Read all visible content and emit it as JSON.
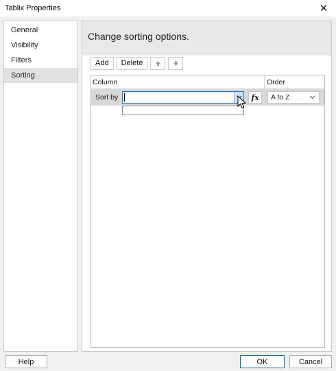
{
  "window": {
    "title": "Tablix Properties",
    "close_glyph": "✕"
  },
  "nav": {
    "items": [
      {
        "label": "General",
        "selected": false
      },
      {
        "label": "Visibility",
        "selected": false
      },
      {
        "label": "Filters",
        "selected": false
      },
      {
        "label": "Sorting",
        "selected": true
      }
    ]
  },
  "main": {
    "heading": "Change sorting options.",
    "toolbar": {
      "add_label": "Add",
      "delete_label": "Delete",
      "move_up_icon": "arrow-up-icon",
      "move_down_icon": "arrow-down-icon"
    },
    "grid": {
      "column_header": "Column",
      "order_header": "Order",
      "rows": [
        {
          "label": "Sort by",
          "column_value": "",
          "order_value": "A to Z"
        }
      ]
    }
  },
  "footer": {
    "help_label": "Help",
    "ok_label": "OK",
    "cancel_label": "Cancel"
  },
  "colors": {
    "accent": "#0067c0",
    "selected_nav": "#e1e1e1",
    "header_band": "#e8e8e8",
    "sort_row": "#d8d8d8"
  }
}
